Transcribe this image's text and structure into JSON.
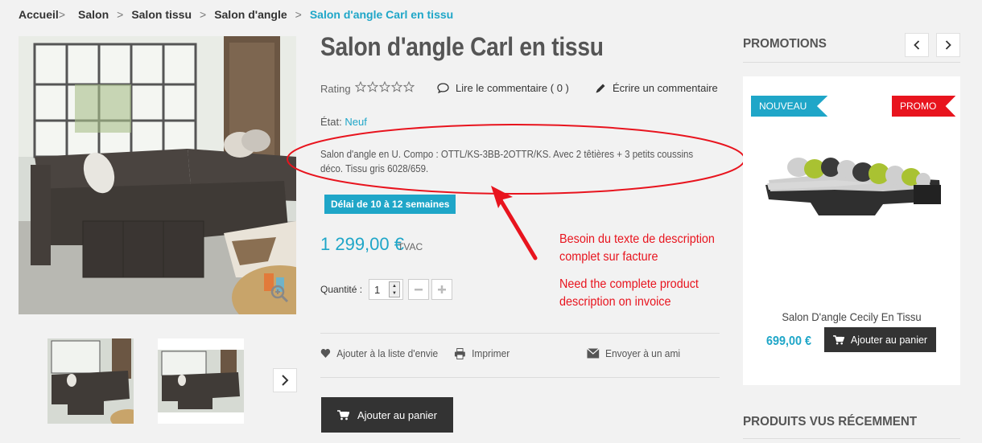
{
  "breadcrumb": {
    "items": [
      "Accueil",
      "Salon",
      "Salon tissu",
      "Salon d'angle",
      "Salon d'angle Carl en tissu"
    ],
    "separator": ">"
  },
  "product": {
    "title": "Salon d'angle Carl en tissu",
    "rating_label": "Rating",
    "rating_value": 0,
    "rating_max": 5,
    "read_review": "Lire le commentaire ( 0 )",
    "write_review": "Écrire un commentaire",
    "condition_label": "État:",
    "condition_value": "Neuf",
    "description": "Salon d'angle en U. Compo : OTTL/KS-3BB-2OTTR/KS. Avec 2 têtières + 3 petits coussins déco. Tissu gris 6028/659.",
    "delay": "Délai de 10 à 12 semaines",
    "price": "1 299,00 €",
    "price_tax": "TVAC",
    "quantity_label": "Quantité :",
    "quantity_value": "1",
    "wishlist": "Ajouter à la liste d'envie",
    "print": "Imprimer",
    "send_friend": "Envoyer à un ami",
    "add_to_cart": "Ajouter au panier"
  },
  "annotation": {
    "text_fr_1": "Besoin du texte de description",
    "text_fr_2": "complet sur facture",
    "text_en_1": "Need the complete product",
    "text_en_2": "description on invoice",
    "color": "#e8141e"
  },
  "sidebar": {
    "promotions_title": "PROMOTIONS",
    "promo_item": {
      "badge_new": "NOUVEAU",
      "badge_promo": "PROMO",
      "name": "Salon D'angle Cecily En Tissu",
      "price": "699,00 €",
      "add_to_cart": "Ajouter au panier"
    },
    "recent_title": "PRODUITS VUS RÉCEMMENT"
  },
  "colors": {
    "accent": "#1fa6c8",
    "dark_button": "#333333",
    "promo_red": "#e8141e"
  }
}
